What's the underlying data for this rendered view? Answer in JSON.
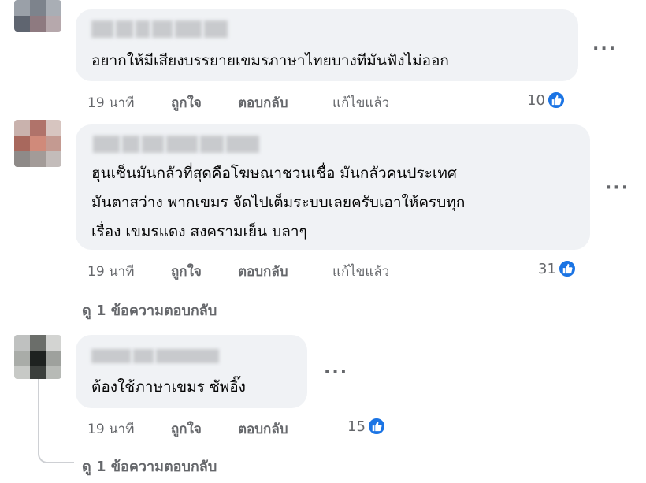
{
  "comments": [
    {
      "text_lines": [
        "อยากให้มีเสียงบรรยายเขมรภาษาไทยบางทีมันฟังไม่ออก"
      ],
      "time": "19 นาที",
      "like_label": "ถูกใจ",
      "reply_label": "ตอบกลับ",
      "edited_label": "แก้ไขแล้ว",
      "reaction_count": "10",
      "more_label": "···"
    },
    {
      "text_lines": [
        "ฮุนเซ็นมันกลัวที่สุดคือโฆษณาชวนเชื่อ มันกลัวคนประเทศ",
        "มันตาสว่าง พากเขมร จัดไปเต็มระบบเลยครับเอาให้ครบทุก",
        "เรื่อง เขมรแดง สงครามเย็น บลาๆ"
      ],
      "time": "19 นาที",
      "like_label": "ถูกใจ",
      "reply_label": "ตอบกลับ",
      "edited_label": "แก้ไขแล้ว",
      "reaction_count": "31",
      "more_label": "···",
      "view_replies": "ดู 1 ข้อความตอบกลับ"
    },
    {
      "text_lines": [
        "ต้องใช้ภาษาเขมร ซัพอิ๊ง"
      ],
      "time": "19 นาที",
      "like_label": "ถูกใจ",
      "reply_label": "ตอบกลับ",
      "reaction_count": "15",
      "more_label": "···",
      "view_replies": "ดู 1 ข้อความตอบกลับ"
    }
  ],
  "icons": {
    "reaction": "like-icon",
    "more": "more-icon"
  },
  "colors": {
    "bubble": "#f0f2f5",
    "meta": "#65676b",
    "like_blue": "#1b74e4"
  }
}
